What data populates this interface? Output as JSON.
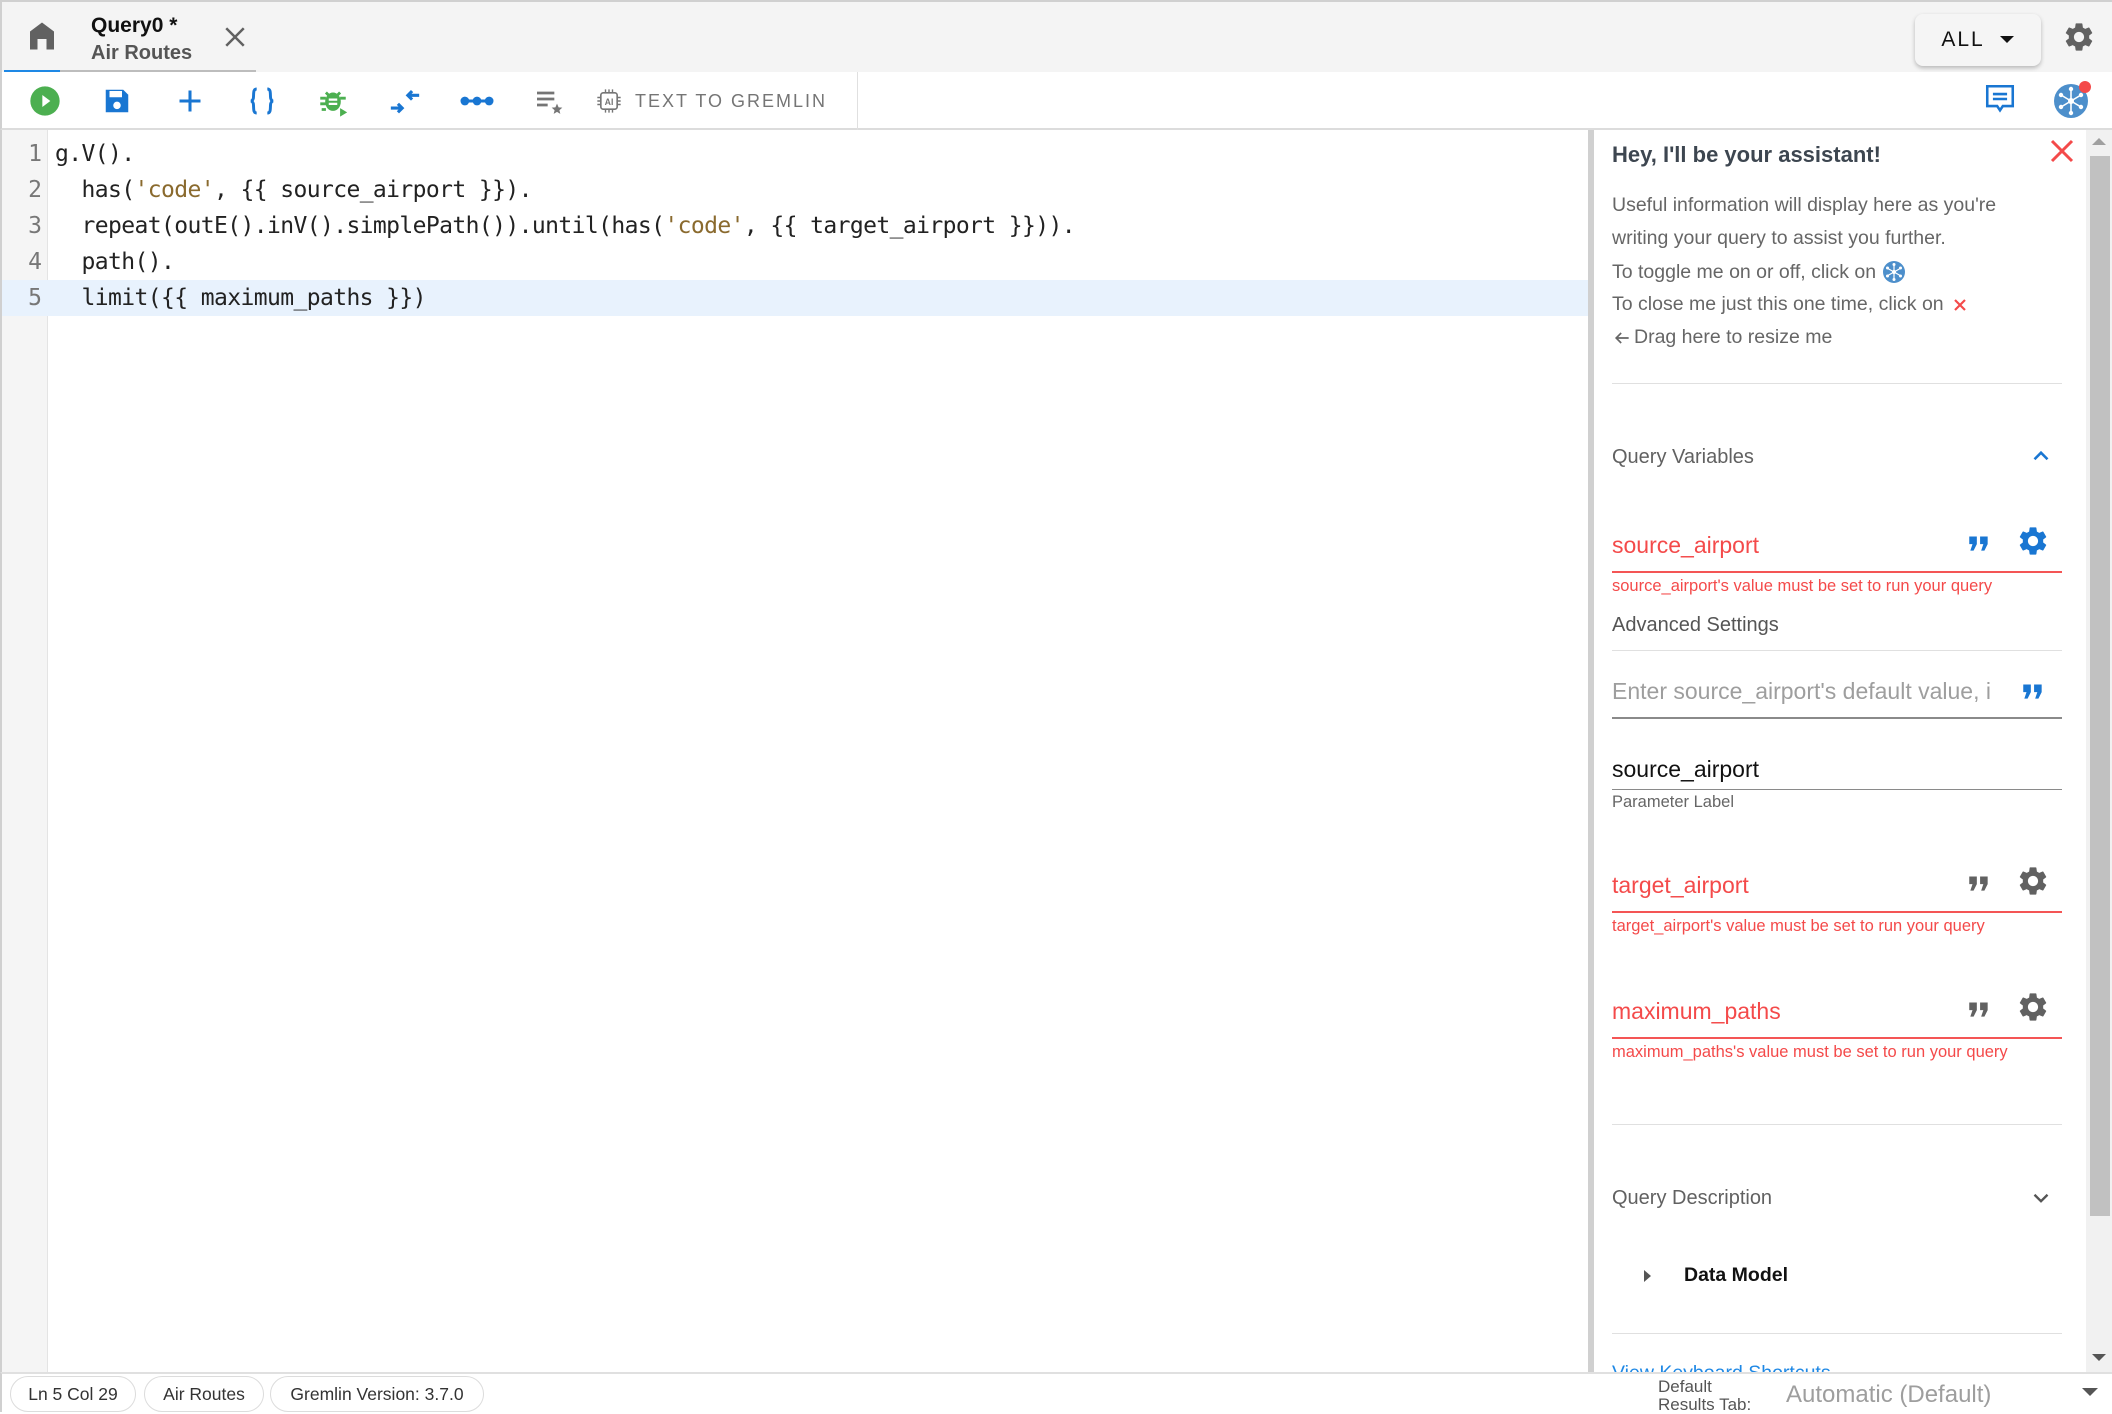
{
  "tabbar": {
    "home_icon": "home-icon",
    "tab": {
      "title": "Query0 *",
      "subtitle": "Air Routes",
      "close_icon": "close-icon"
    },
    "mode_select": {
      "label": "ALL",
      "icon": "caret-down-icon"
    },
    "settings_icon": "gear-icon"
  },
  "toolbar": {
    "buttons": [
      {
        "name": "run",
        "icon": "play-circle-icon",
        "color": "#4caf50"
      },
      {
        "name": "save",
        "icon": "floppy-disk-icon",
        "color": "#1976d2"
      },
      {
        "name": "new-query",
        "icon": "plus-icon",
        "color": "#1976d2"
      },
      {
        "name": "format",
        "icon": "curly-braces-icon",
        "color": "#1976d2"
      },
      {
        "name": "debug",
        "icon": "bug-play-icon",
        "color": "#4caf50"
      },
      {
        "name": "compress",
        "icon": "compress-arrows-icon",
        "color": "#1976d2"
      },
      {
        "name": "path",
        "icon": "connected-dots-icon",
        "color": "#1976d2"
      },
      {
        "name": "favorites",
        "icon": "list-star-icon",
        "color": "#757575"
      }
    ],
    "text_to_gremlin_label": "TEXT TO GREMLIN",
    "text_to_gremlin_icon": "ai-chip-icon",
    "right_icons": [
      {
        "name": "feedback",
        "icon": "chat-message-icon",
        "color": "#1976d2"
      },
      {
        "name": "assistant-toggle",
        "icon": "graph-network-icon",
        "color": "#4d8fcb",
        "badge_color": "#f44a4a"
      }
    ]
  },
  "editor": {
    "lines": [
      {
        "number": "1",
        "segments": [
          {
            "text": "g.V().",
            "type": "plain"
          }
        ]
      },
      {
        "number": "2",
        "segments": [
          {
            "text": "  has(",
            "type": "plain"
          },
          {
            "text": "'code'",
            "type": "string"
          },
          {
            "text": ", {{ source_airport }}).",
            "type": "plain"
          }
        ]
      },
      {
        "number": "3",
        "segments": [
          {
            "text": "  repeat(outE().inV().simplePath()).until(has(",
            "type": "plain"
          },
          {
            "text": "'code'",
            "type": "string"
          },
          {
            "text": ", {{ target_airport }})).",
            "type": "plain"
          }
        ]
      },
      {
        "number": "4",
        "segments": [
          {
            "text": "  path().",
            "type": "plain"
          }
        ]
      },
      {
        "number": "5",
        "segments": [
          {
            "text": "  limit({{ maximum_paths }})",
            "type": "plain"
          }
        ],
        "active": true
      }
    ]
  },
  "assistant": {
    "title": "Hey, I'll be your assistant!",
    "info": {
      "line1": "Useful information will display here as you're",
      "line2": "writing your query to assist you further.",
      "toggle_text": "To toggle me on or off, click on",
      "close_text": "To close me just this one time, click on",
      "resize_text": "Drag here to resize me"
    },
    "query_variables": {
      "heading": "Query Variables",
      "expanded": true,
      "variables": [
        {
          "name": "source_airport",
          "error": "source_airport's value must be set to run your query",
          "advanced_open": true,
          "advanced_label": "Advanced Settings",
          "default_value_placeholder": "Enter source_airport's default value, i",
          "default_value": "",
          "parameter_label_value": "source_airport",
          "parameter_label_caption": "Parameter Label"
        },
        {
          "name": "target_airport",
          "error": "target_airport's value must be set to run your query"
        },
        {
          "name": "maximum_paths",
          "error": "maximum_paths's value must be set to run your query"
        }
      ]
    },
    "query_description": {
      "heading": "Query Description",
      "expanded": false,
      "items": [
        {
          "label": "Data Model"
        }
      ]
    },
    "keyboard_shortcuts_link": "View Keyboard Shortcuts"
  },
  "statusbar": {
    "position": "Ln 5 Col 29",
    "graph": "Air Routes",
    "version": "Gremlin Version: 3.7.0",
    "results_tab_label_line1": "Default",
    "results_tab_label_line2": "Results Tab:",
    "results_tab_value": "Automatic (Default)"
  },
  "colors": {
    "accent_blue": "#1e88e5",
    "error_red": "#f44a4a",
    "run_green": "#4caf50"
  }
}
